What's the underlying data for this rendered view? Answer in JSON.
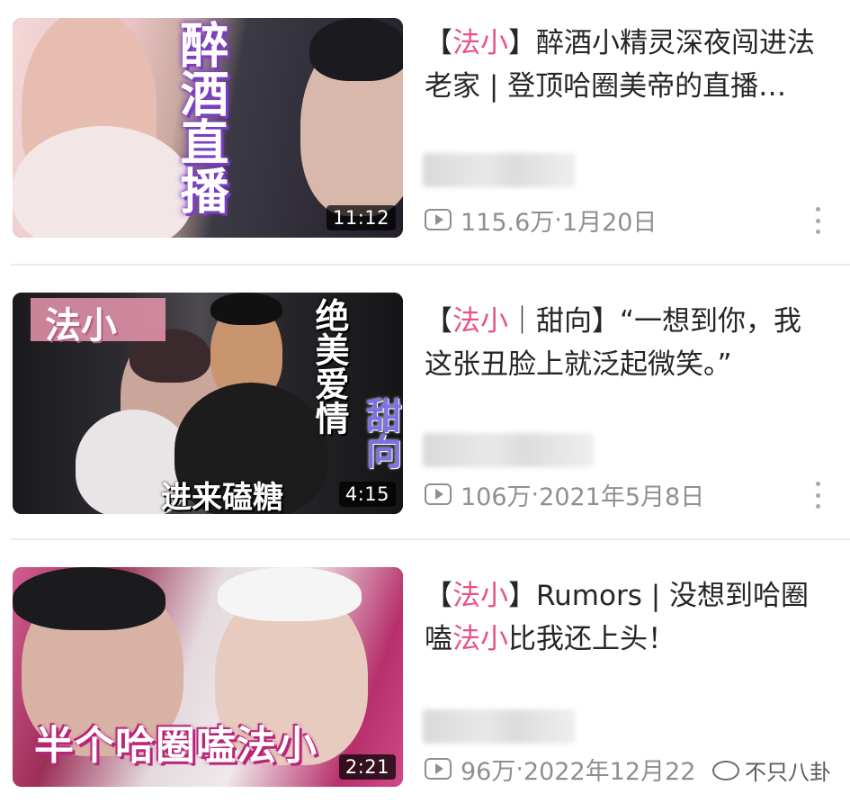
{
  "videos": [
    {
      "title_prefix": "【",
      "title_tag": "法小",
      "title_rest": "】醉酒小精灵深夜闯进法老家 | 登顶哈圈美帝的直播…",
      "duration": "11:12",
      "thumb_text": "醉酒直播",
      "views": "115.6万",
      "separator": " · ",
      "date": "1月20日"
    },
    {
      "title_prefix": "【",
      "title_tag": "法小",
      "title_rest": "｜甜向】“一想到你，我这张丑脸上就泛起微笑。”",
      "duration": "4:15",
      "thumb_tag": "法小",
      "thumb_side_text": "绝美爱情",
      "thumb_side_text2": "甜向",
      "thumb_caption": "进来磕糖",
      "views": "106万",
      "separator": " · ",
      "date": "2021年5月8日"
    },
    {
      "title_prefix": "【",
      "title_tag": "法小",
      "title_mid": "】Rumors | 没想到哈圈嗑",
      "title_tag2": "法小",
      "title_rest": "比我还上头！",
      "duration": "2:21",
      "thumb_caption": "半个哈圈嗑法小",
      "views": "96万",
      "separator": " · ",
      "date": "2022年12月22"
    }
  ],
  "watermark": "不只八卦",
  "colors": {
    "accent_pink": "#e8518a",
    "meta_gray": "#8f8f8f"
  },
  "icons": [
    "play-count-icon",
    "more-vertical-icon",
    "wechat-icon"
  ]
}
